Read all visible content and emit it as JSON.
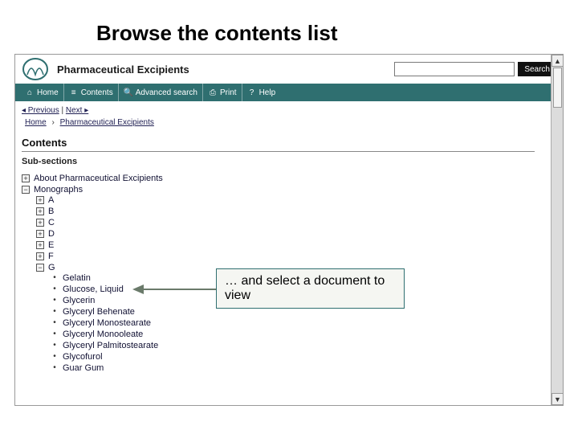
{
  "slide": {
    "title": "Browse the contents list"
  },
  "header": {
    "app_title": "Pharmaceutical Excipients",
    "search_placeholder": "",
    "search_button": "Search"
  },
  "toolbar": {
    "items": [
      {
        "icon": "⌂",
        "label": "Home"
      },
      {
        "icon": "≡",
        "label": "Contents"
      },
      {
        "icon": "🔍",
        "label": "Advanced search"
      },
      {
        "icon": "⎙",
        "label": "Print"
      },
      {
        "icon": "?",
        "label": "Help"
      }
    ]
  },
  "nav": {
    "prev": "◂ Previous",
    "next": "Next ▸",
    "breadcrumb": [
      "Home",
      "Pharmaceutical Excipients"
    ]
  },
  "contents": {
    "heading": "Contents",
    "sub_heading": "Sub-sections",
    "root": [
      {
        "expand": "+",
        "label": "About Pharmaceutical Excipients"
      },
      {
        "expand": "−",
        "label": "Monographs",
        "children_letters": [
          {
            "expand": "+",
            "label": "A"
          },
          {
            "expand": "+",
            "label": "B"
          },
          {
            "expand": "+",
            "label": "C"
          },
          {
            "expand": "+",
            "label": "D"
          },
          {
            "expand": "+",
            "label": "E"
          },
          {
            "expand": "+",
            "label": "F"
          },
          {
            "expand": "−",
            "label": "G",
            "children_mono": [
              {
                "label": "Gelatin"
              },
              {
                "label": "Glucose, Liquid"
              },
              {
                "label": "Glycerin"
              },
              {
                "label": "Glyceryl Behenate"
              },
              {
                "label": "Glyceryl Monostearate"
              },
              {
                "label": "Glyceryl Monooleate"
              },
              {
                "label": "Glyceryl Palmitostearate"
              },
              {
                "label": "Glycofurol"
              },
              {
                "label": "Guar Gum"
              }
            ]
          }
        ]
      }
    ]
  },
  "callout": {
    "text": "… and select a document to view"
  }
}
